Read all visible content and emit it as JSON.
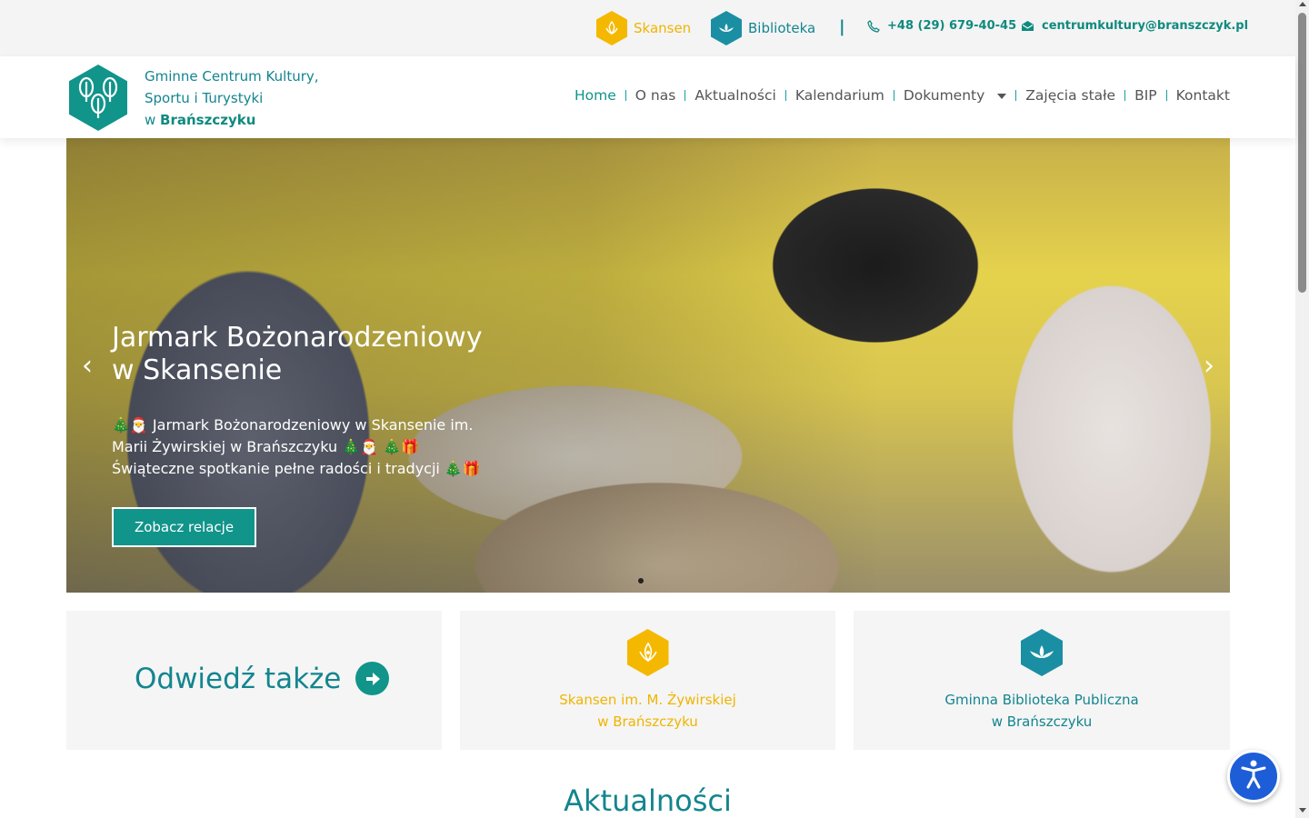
{
  "topbar": {
    "skansen_label": "Skansen",
    "biblioteka_label": "Biblioteka",
    "separator": "|",
    "phone": "+48 (29) 679-40-45",
    "email": "centrumkultury@branszczyk.pl",
    "icons": [
      "skansen-flower-icon",
      "biblioteka-lotus-icon",
      "phone-icon",
      "mail-icon"
    ]
  },
  "header": {
    "logo_line1": "Gminne Centrum Kultury,",
    "logo_line2": "Sportu i Turystyki",
    "logo_line3_prefix": "w ",
    "logo_line3_bold": "Brańszczyku",
    "nav": [
      {
        "label": "Home",
        "active": true
      },
      {
        "label": "O nas"
      },
      {
        "label": "Aktualności"
      },
      {
        "label": "Kalendarium"
      },
      {
        "label": "Dokumenty",
        "dropdown": true
      },
      {
        "label": "Zajęcia stałe"
      },
      {
        "label": "BIP"
      },
      {
        "label": "Kontakt"
      }
    ]
  },
  "slider": {
    "title_line1": "Jarmark Bożonarodzeniowy",
    "title_line2": "w Skansenie",
    "description": "🎄🎅 Jarmark Bożonarodzeniowy w Skansenie im. Marii Żywirskiej w Brańszczyku 🎄🎅 🎄🎁 Świąteczne spotkanie pełne radości i tradycji 🎄🎁",
    "button_label": "Zobacz relacje",
    "prev_label": "‹",
    "next_label": "›",
    "slide_count": 1,
    "active_slide": 1
  },
  "visit": {
    "heading": "Odwiedź także",
    "box2_line1": "Skansen im. M. Żywirskiej",
    "box2_line2": "w Brańszczyku",
    "box3_line1": "Gminna Biblioteka Publiczna",
    "box3_line2": "w Brańszczyku"
  },
  "news": {
    "heading": "Aktualności"
  },
  "colors": {
    "teal": "#11948a",
    "yellow": "#f5b800",
    "accessibility_blue": "#1d5ed8"
  }
}
